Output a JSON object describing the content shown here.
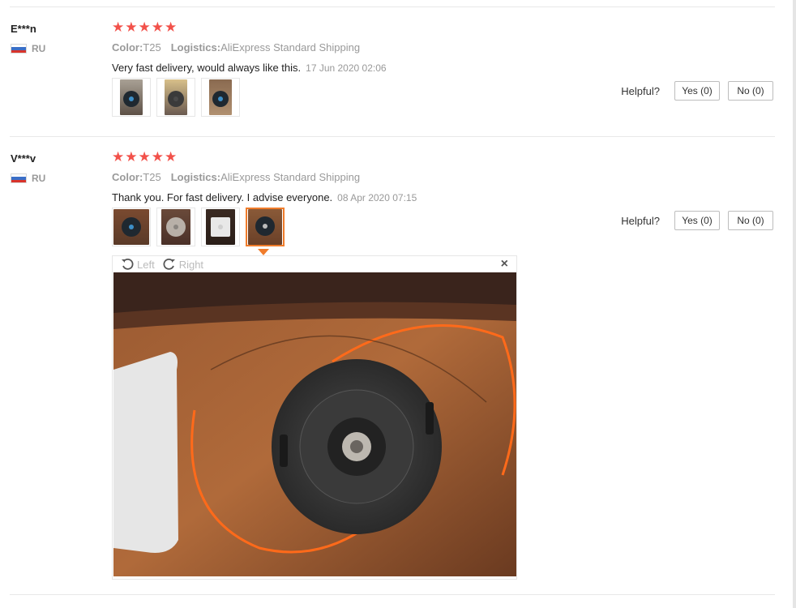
{
  "reviews": [
    {
      "user": "E***n",
      "country": "RU",
      "stars": "★★★★★",
      "color_label": "Color:",
      "color_value": "T25",
      "logistics_label": "Logistics:",
      "logistics_value": "AliExpress Standard Shipping",
      "text": "Very fast delivery, would always like this.",
      "date": "17 Jun 2020 02:06",
      "helpful_label": "Helpful?",
      "yes_label": "Yes (0)",
      "no_label": "No (0)",
      "thumb_count": 3
    },
    {
      "user": "V***v",
      "country": "RU",
      "stars": "★★★★★",
      "color_label": "Color:",
      "color_value": "T25",
      "logistics_label": "Logistics:",
      "logistics_value": "AliExpress Standard Shipping",
      "text": "Thank you. For fast delivery. I advise everyone.",
      "date": "08 Apr 2020 07:15",
      "helpful_label": "Helpful?",
      "yes_label": "Yes (0)",
      "no_label": "No (0)",
      "thumb_count": 4
    }
  ],
  "viewer": {
    "rotate_left": "Left",
    "rotate_right": "Right",
    "close": "×"
  },
  "colors": {
    "star": "#f2514a",
    "active_thumb": "#f07c2b"
  }
}
